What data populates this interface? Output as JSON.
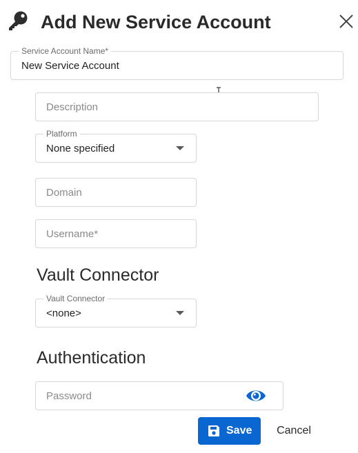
{
  "header": {
    "title": "Add New Service Account",
    "key_icon": "key-icon",
    "close_icon": "close-icon"
  },
  "fields": {
    "service_account_name": {
      "label": "Service Account Name*",
      "value": "New Service Account"
    },
    "description": {
      "placeholder": "Description",
      "value": ""
    },
    "platform": {
      "label": "Platform",
      "selected": "None specified"
    },
    "domain": {
      "placeholder": "Domain",
      "value": ""
    },
    "username": {
      "placeholder": "Username*",
      "value": ""
    }
  },
  "vault_connector_section": {
    "title": "Vault Connector",
    "select": {
      "label": "Vault Connector",
      "selected": "<none>"
    }
  },
  "authentication_section": {
    "title": "Authentication",
    "password": {
      "placeholder": "Password",
      "value": "",
      "toggle_icon": "eye-icon"
    }
  },
  "actions": {
    "save_label": "Save",
    "save_icon": "floppy-disk-icon",
    "cancel_label": "Cancel"
  },
  "colors": {
    "primary": "#0a66d1",
    "border": "#d7d7d7",
    "text": "#212121",
    "placeholder": "#8a8a8a"
  }
}
